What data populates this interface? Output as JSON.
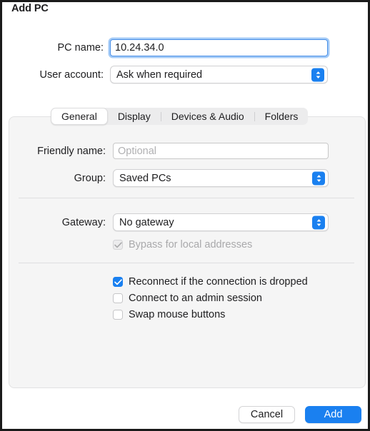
{
  "dialog": {
    "title": "Add PC"
  },
  "top_form": {
    "pc_name": {
      "label": "PC name:",
      "value": "10.24.34.0"
    },
    "user_account": {
      "label": "User account:",
      "value": "Ask when required"
    }
  },
  "tabs": [
    {
      "label": "General",
      "selected": true
    },
    {
      "label": "Display",
      "selected": false
    },
    {
      "label": "Devices & Audio",
      "selected": false
    },
    {
      "label": "Folders",
      "selected": false
    }
  ],
  "general_tab": {
    "friendly_name": {
      "label": "Friendly name:",
      "value": "",
      "placeholder": "Optional"
    },
    "group": {
      "label": "Group:",
      "value": "Saved PCs"
    },
    "gateway": {
      "label": "Gateway:",
      "value": "No gateway"
    },
    "bypass_local": {
      "label": "Bypass for local addresses",
      "checked": true,
      "disabled": true
    },
    "options": [
      {
        "label": "Reconnect if the connection is dropped",
        "checked": true
      },
      {
        "label": "Connect to an admin session",
        "checked": false
      },
      {
        "label": "Swap mouse buttons",
        "checked": false
      }
    ]
  },
  "footer": {
    "cancel_label": "Cancel",
    "add_label": "Add"
  },
  "colors": {
    "accent": "#1a80f0",
    "panel_bg": "#f5f5f5",
    "window_bg": "#ffffff",
    "text": "#1d1d1f",
    "placeholder": "#b0b0b2",
    "disabled_text": "#a9a9ab"
  }
}
